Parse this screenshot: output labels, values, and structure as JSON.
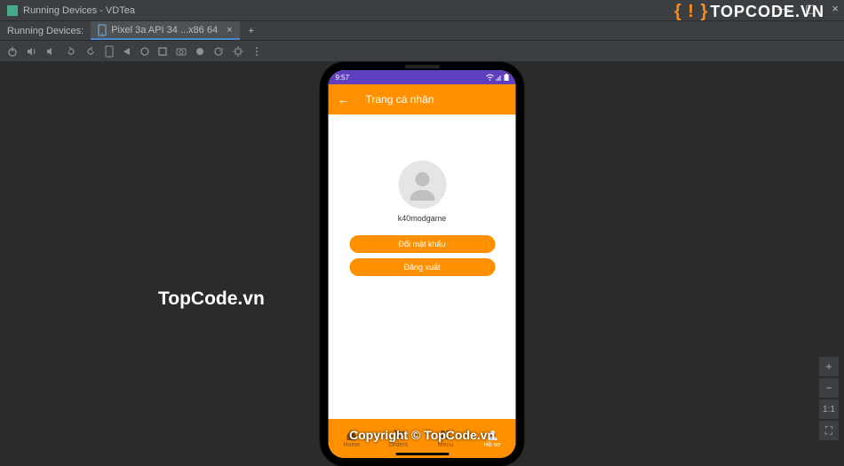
{
  "window": {
    "title": "Running Devices - VDTea"
  },
  "win_controls": {
    "min": "—",
    "max": "▢",
    "close": "×"
  },
  "tabs": {
    "group_label": "Running Devices:",
    "active": "Pixel 3a API 34 ...x86 64",
    "close": "×",
    "plus": "+"
  },
  "toolbar_icons": [
    "power",
    "volume",
    "rotate-left",
    "rotate-right",
    "frame",
    "back-triangle",
    "circle",
    "square",
    "camera",
    "record",
    "refresh",
    "chip",
    "more"
  ],
  "watermark": {
    "left": "TopCode.vn",
    "logo_brackets": "{ ! }",
    "logo_text": "TOPCODE.VN",
    "bottom": "Copyright © TopCode.vn"
  },
  "zoom": {
    "plus": "+",
    "minus": "−",
    "ratio": "1:1",
    "fit": "⛶"
  },
  "phone": {
    "status": {
      "time": "9:57",
      "battery_icon": "▮"
    },
    "appbar": {
      "back": "←",
      "title": "Trang cá nhân"
    },
    "profile": {
      "username": "k40modgame"
    },
    "buttons": {
      "change_password": "Đổi mật khẩu",
      "logout": "Đăng xuất"
    },
    "nav": {
      "items": [
        {
          "icon": "home",
          "label": "Home"
        },
        {
          "icon": "cart",
          "label": "Orders"
        },
        {
          "icon": "grid",
          "label": "Menu"
        },
        {
          "icon": "person",
          "label": "Hồ sơ"
        }
      ],
      "activeIndex": 3
    }
  }
}
